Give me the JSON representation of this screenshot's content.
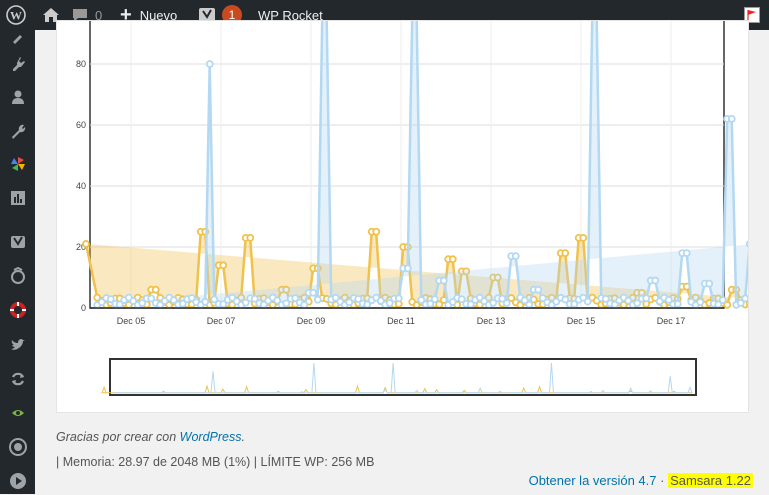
{
  "adminbar": {
    "comments_count": "0",
    "new_label": "Nuevo",
    "notification_count": "1",
    "plugin_label": "WP Rocket"
  },
  "sidebar": {
    "icons": [
      "appearance-icon",
      "plugins-icon",
      "users-icon",
      "tools-icon",
      "pinwheel-icon",
      "stats-icon",
      "yoast-icon",
      "backup-icon",
      "lifebuoy-icon",
      "twitter-icon",
      "sync-icon",
      "eye-icon",
      "wordpress-icon",
      "play-icon"
    ]
  },
  "chart_data": {
    "type": "line",
    "y_ticks": [
      "0",
      "20",
      "40",
      "60",
      "80"
    ],
    "x_ticks": [
      "Dec 05",
      "Dec 07",
      "Dec 09",
      "Dec 11",
      "Dec 13",
      "Dec 15",
      "Dec 17"
    ],
    "ylim": [
      0,
      85
    ],
    "grid": true,
    "series": [
      {
        "color": "#f0c14b",
        "peaks": [
          [
            4.0,
            21
          ],
          [
            5.5,
            6
          ],
          [
            6.6,
            25
          ],
          [
            7.0,
            14
          ],
          [
            7.6,
            23
          ],
          [
            8.4,
            6
          ],
          [
            9.1,
            13
          ],
          [
            10.4,
            25
          ],
          [
            11.1,
            20
          ],
          [
            12.1,
            16
          ],
          [
            12.4,
            12
          ],
          [
            13.1,
            10
          ],
          [
            14.6,
            18
          ],
          [
            15.0,
            23
          ],
          [
            16.3,
            5
          ],
          [
            17.3,
            7
          ],
          [
            18.4,
            6
          ]
        ],
        "values_note": ""
      },
      {
        "color": "#b3d8f2",
        "peaks": [
          [
            6.75,
            80
          ],
          [
            9.3,
            110
          ],
          [
            11.3,
            110
          ],
          [
            11.9,
            9
          ],
          [
            13.5,
            17
          ],
          [
            14.0,
            6
          ],
          [
            15.3,
            110
          ],
          [
            16.6,
            9
          ],
          [
            17.3,
            18
          ],
          [
            18.3,
            62
          ],
          [
            18.8,
            21
          ],
          [
            17.8,
            8
          ],
          [
            11.1,
            13
          ],
          [
            9.0,
            5
          ]
        ],
        "values_note": ""
      }
    ]
  },
  "footer": {
    "thanks_text": "Gracias por crear con",
    "wordpress_link": "WordPress",
    "period": ".",
    "memory_text": "| Memoria: 28.97 de 2048 MB (1%) | LÍMITE WP: 256 MB",
    "update_link": "Obtener la versión 4.7",
    "separator": " · ",
    "samsara_version": "Samsara 1.22"
  }
}
